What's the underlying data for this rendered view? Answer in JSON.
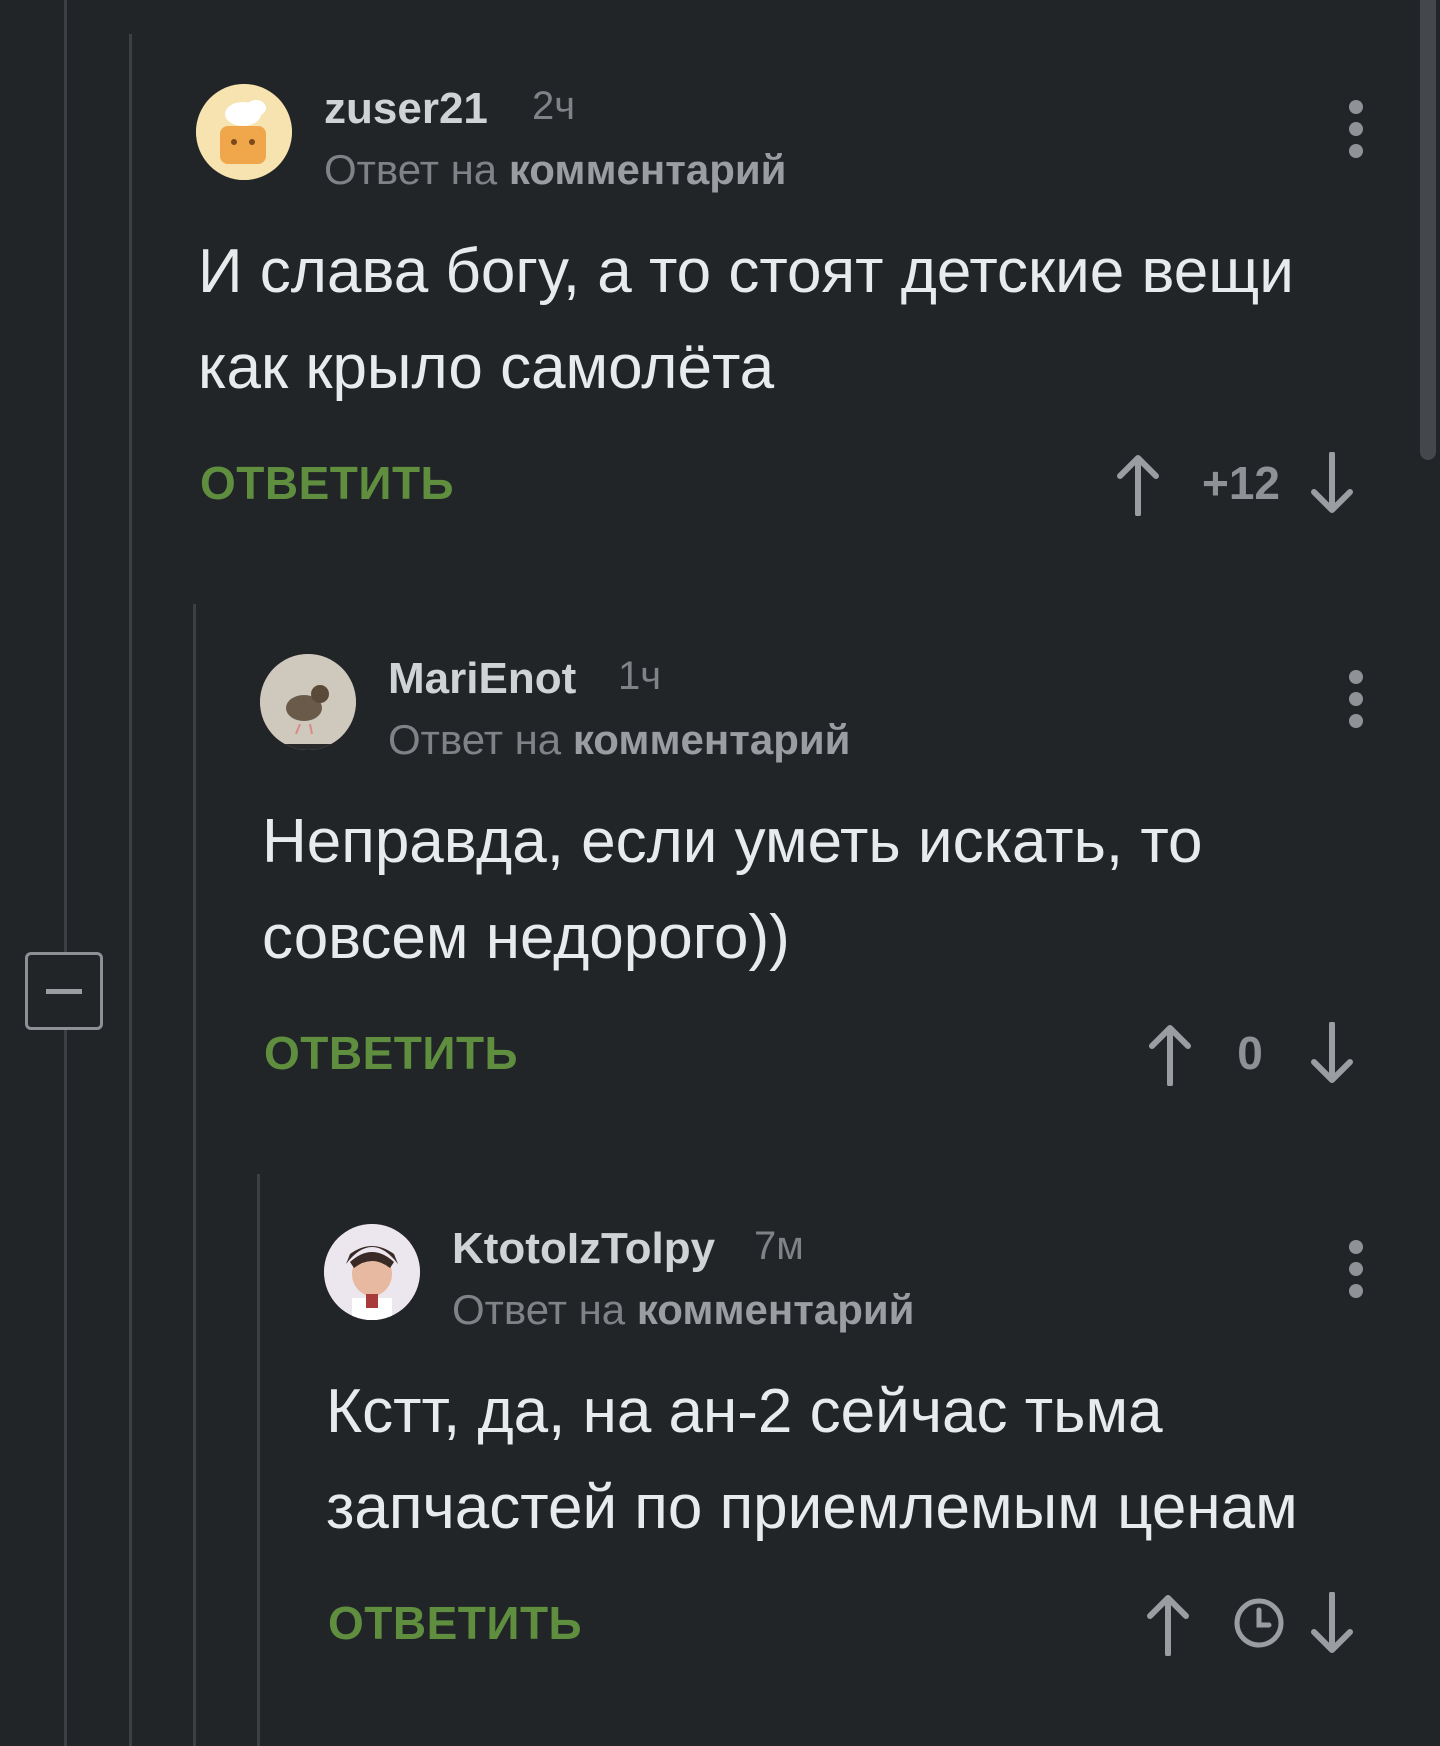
{
  "comments": [
    {
      "author": "zuser21",
      "time": "2ч",
      "reply_prefix": "Ответ на",
      "reply_target": "комментарий",
      "text_lines": [
        "И слава богу, а то стоят детские вещи",
        "как крыло самолёта"
      ],
      "reply_label": "ОТВЕТИТЬ",
      "score": "+12"
    },
    {
      "author": "MariEnot",
      "time": "1ч",
      "reply_prefix": "Ответ на",
      "reply_target": "комментарий",
      "text_lines": [
        "Неправда, если уметь искать, то",
        "совсем недорого))"
      ],
      "reply_label": "ОТВЕТИТЬ",
      "score": "0"
    },
    {
      "author": "KtotoIzTolpy",
      "time": "7м",
      "reply_prefix": "Ответ на",
      "reply_target": "комментарий",
      "text_lines": [
        "Кстт, да, на ан-2 сейчас тьма",
        "запчастей по приемлемым ценам"
      ],
      "reply_label": "ОТВЕТИТЬ",
      "score_icon": "clock-icon"
    }
  ],
  "colors": {
    "background": "#222528",
    "reply_green": "#5f8f3e",
    "muted": "#7f8387"
  }
}
